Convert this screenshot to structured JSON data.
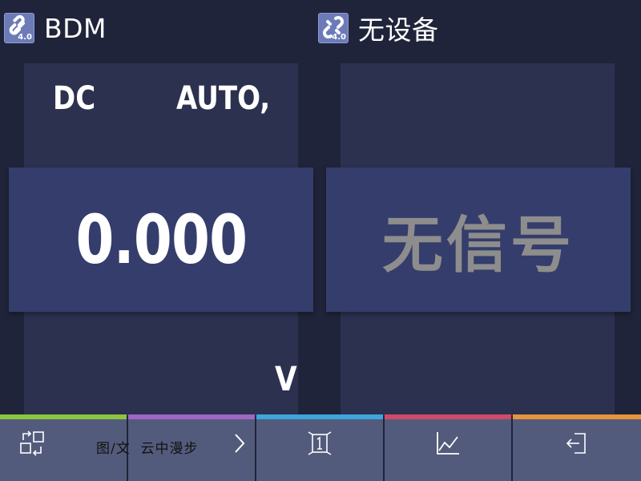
{
  "header": {
    "left": {
      "icon": "link-icon",
      "version": "4.0",
      "title": "BDM"
    },
    "right": {
      "icon": "broken-link-icon",
      "version": "4.0",
      "title": "无设备"
    }
  },
  "left_panel": {
    "coupling": "DC",
    "range": "AUTO,",
    "reading": "0.000",
    "unit": "V"
  },
  "right_panel": {
    "status": "无信号"
  },
  "toolbar": {
    "buttons": [
      {
        "icon": "swap-icon",
        "accent": "#8cc63f"
      },
      {
        "icon": "chevron-right-icon",
        "accent": "#a066c4"
      },
      {
        "icon": "single-view-icon",
        "accent": "#3da6dc"
      },
      {
        "icon": "trend-chart-icon",
        "accent": "#d24a6a"
      },
      {
        "icon": "exit-icon",
        "accent": "#e8943a"
      }
    ]
  },
  "watermark": "图/文  云中漫步",
  "colors": {
    "background": "#20243a",
    "panel": "#2c3150",
    "value_box": "#353d6c",
    "toolbar": "#535b7c",
    "no_signal_text": "#8d8d8d"
  }
}
